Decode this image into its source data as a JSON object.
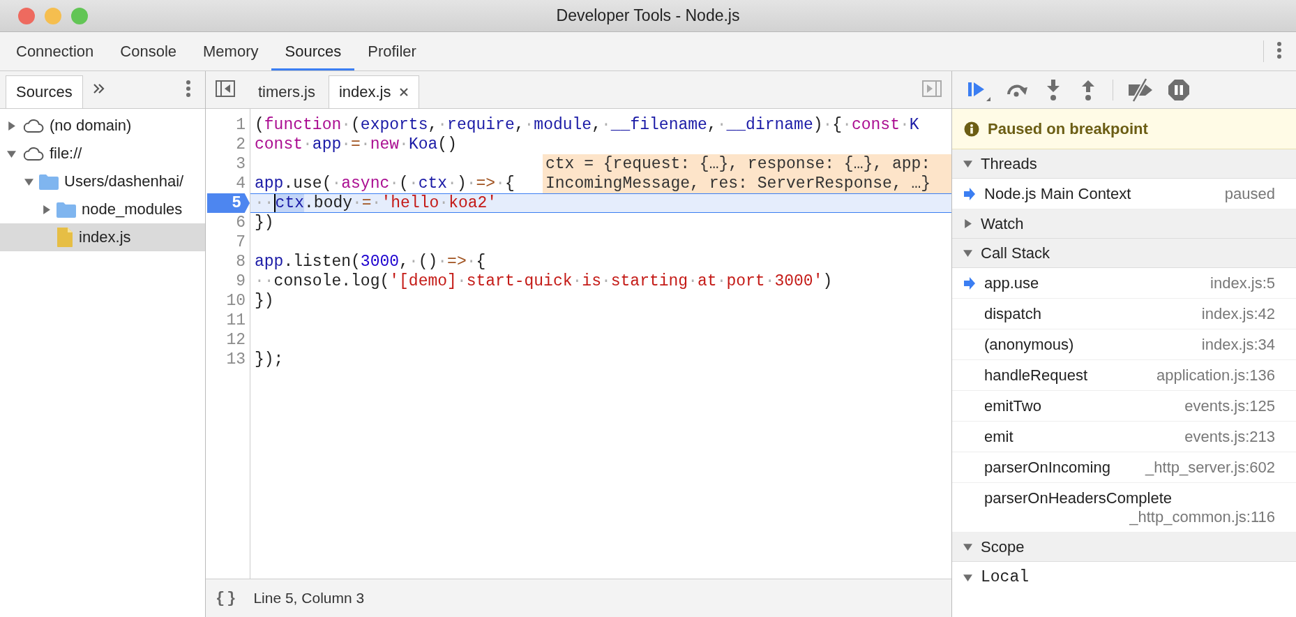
{
  "window": {
    "title": "Developer Tools - Node.js"
  },
  "tabs": [
    {
      "label": "Connection",
      "selected": false
    },
    {
      "label": "Console",
      "selected": false
    },
    {
      "label": "Memory",
      "selected": false
    },
    {
      "label": "Sources",
      "selected": true
    },
    {
      "label": "Profiler",
      "selected": false
    }
  ],
  "sidebar": {
    "tabs": [
      {
        "label": "Sources",
        "selected": true
      }
    ],
    "tree": [
      {
        "label": "(no domain)",
        "kind": "domain",
        "expanded": false,
        "selected": false
      },
      {
        "label": "file://",
        "kind": "domain",
        "expanded": true,
        "selected": false,
        "children": [
          {
            "label": "Users/dashenhai/",
            "kind": "folder",
            "expanded": true,
            "selected": false,
            "children": [
              {
                "label": "node_modules",
                "kind": "folder",
                "expanded": false,
                "selected": false
              },
              {
                "label": "index.js",
                "kind": "file",
                "selected": true
              }
            ]
          }
        ]
      }
    ]
  },
  "editor": {
    "tabs": [
      {
        "label": "timers.js",
        "selected": false,
        "closable": false
      },
      {
        "label": "index.js",
        "selected": true,
        "closable": true
      }
    ],
    "lines": [
      {
        "number": "1",
        "active": false,
        "tokens": [
          {
            "kind": "plain",
            "text": "("
          },
          {
            "kind": "kw",
            "text": "function"
          },
          {
            "kind": "ws",
            "text": "·"
          },
          {
            "kind": "plain",
            "text": "("
          },
          {
            "kind": "var",
            "text": "exports"
          },
          {
            "kind": "plain",
            "text": ","
          },
          {
            "kind": "ws",
            "text": "·"
          },
          {
            "kind": "var",
            "text": "require"
          },
          {
            "kind": "plain",
            "text": ","
          },
          {
            "kind": "ws",
            "text": "·"
          },
          {
            "kind": "var",
            "text": "module"
          },
          {
            "kind": "plain",
            "text": ","
          },
          {
            "kind": "ws",
            "text": "·"
          },
          {
            "kind": "var",
            "text": "__filename"
          },
          {
            "kind": "plain",
            "text": ","
          },
          {
            "kind": "ws",
            "text": "·"
          },
          {
            "kind": "var",
            "text": "__dirname"
          },
          {
            "kind": "plain",
            "text": ")"
          },
          {
            "kind": "ws",
            "text": "·"
          },
          {
            "kind": "plain",
            "text": "{"
          },
          {
            "kind": "ws",
            "text": "·"
          },
          {
            "kind": "kw",
            "text": "const"
          },
          {
            "kind": "ws",
            "text": "·"
          },
          {
            "kind": "var",
            "text": "K"
          }
        ]
      },
      {
        "number": "2",
        "active": false,
        "tokens": [
          {
            "kind": "kw",
            "text": "const"
          },
          {
            "kind": "ws",
            "text": "·"
          },
          {
            "kind": "var",
            "text": "app"
          },
          {
            "kind": "ws",
            "text": "·"
          },
          {
            "kind": "op",
            "text": "="
          },
          {
            "kind": "ws",
            "text": "·"
          },
          {
            "kind": "kw",
            "text": "new"
          },
          {
            "kind": "ws",
            "text": "·"
          },
          {
            "kind": "var",
            "text": "Koa"
          },
          {
            "kind": "plain",
            "text": "()"
          }
        ]
      },
      {
        "number": "3",
        "active": false
      },
      {
        "number": "4",
        "active": false,
        "tokens": [
          {
            "kind": "var",
            "text": "app"
          },
          {
            "kind": "plain",
            "text": ".use("
          },
          {
            "kind": "ws",
            "text": "·"
          },
          {
            "kind": "kw",
            "text": "async"
          },
          {
            "kind": "ws",
            "text": "·"
          },
          {
            "kind": "plain",
            "text": "("
          },
          {
            "kind": "ws",
            "text": "·"
          },
          {
            "kind": "var",
            "text": "ctx"
          },
          {
            "kind": "ws",
            "text": "·"
          },
          {
            "kind": "plain",
            "text": ")"
          },
          {
            "kind": "ws",
            "text": "·"
          },
          {
            "kind": "op",
            "text": "=>"
          },
          {
            "kind": "ws",
            "text": "·"
          },
          {
            "kind": "plain",
            "text": "{"
          }
        ]
      },
      {
        "number": "5",
        "active": true,
        "tokens": [
          {
            "kind": "ws",
            "text": "··"
          },
          {
            "kind": "match",
            "text": "ctx"
          },
          {
            "kind": "plain",
            "text": ".body"
          },
          {
            "kind": "ws",
            "text": "·"
          },
          {
            "kind": "op",
            "text": "="
          },
          {
            "kind": "ws",
            "text": "·"
          },
          {
            "kind": "str",
            "text": "'hello"
          },
          {
            "kind": "ws",
            "text": "·"
          },
          {
            "kind": "str",
            "text": "koa2'"
          }
        ]
      },
      {
        "number": "6",
        "active": false,
        "tokens": [
          {
            "kind": "plain",
            "text": "})"
          }
        ]
      },
      {
        "number": "7",
        "active": false
      },
      {
        "number": "8",
        "active": false,
        "tokens": [
          {
            "kind": "var",
            "text": "app"
          },
          {
            "kind": "plain",
            "text": ".listen("
          },
          {
            "kind": "num",
            "text": "3000"
          },
          {
            "kind": "plain",
            "text": ","
          },
          {
            "kind": "ws",
            "text": "·"
          },
          {
            "kind": "plain",
            "text": "()"
          },
          {
            "kind": "ws",
            "text": "·"
          },
          {
            "kind": "op",
            "text": "=>"
          },
          {
            "kind": "ws",
            "text": "·"
          },
          {
            "kind": "plain",
            "text": "{"
          }
        ]
      },
      {
        "number": "9",
        "active": false,
        "tokens": [
          {
            "kind": "ws",
            "text": "··"
          },
          {
            "kind": "plain",
            "text": "console.log("
          },
          {
            "kind": "str",
            "text": "'[demo]"
          },
          {
            "kind": "ws",
            "text": "·"
          },
          {
            "kind": "str",
            "text": "start-quick"
          },
          {
            "kind": "ws",
            "text": "·"
          },
          {
            "kind": "str",
            "text": "is"
          },
          {
            "kind": "ws",
            "text": "·"
          },
          {
            "kind": "str",
            "text": "starting"
          },
          {
            "kind": "ws",
            "text": "·"
          },
          {
            "kind": "str",
            "text": "at"
          },
          {
            "kind": "ws",
            "text": "·"
          },
          {
            "kind": "str",
            "text": "port"
          },
          {
            "kind": "ws",
            "text": "·"
          },
          {
            "kind": "str",
            "text": "3000'"
          },
          {
            "kind": "plain",
            "text": ")"
          }
        ]
      },
      {
        "number": "10",
        "active": false,
        "tokens": [
          {
            "kind": "plain",
            "text": "})"
          }
        ]
      },
      {
        "number": "11",
        "active": false
      },
      {
        "number": "12",
        "active": false
      },
      {
        "number": "13",
        "active": false,
        "tokens": [
          {
            "kind": "plain",
            "text": "});"
          }
        ]
      }
    ],
    "tooltip": "ctx = {request: {…}, response: {…}, app: IncomingMessage, res: ServerResponse, …}",
    "status": {
      "format_button": "{}",
      "position": "Line 5, Column 3"
    }
  },
  "debugger": {
    "banner": "Paused on breakpoint",
    "sections": [
      {
        "kind": "threads",
        "title": "Threads",
        "expanded": true,
        "items": [
          {
            "name": "Node.js Main Context",
            "status": "paused",
            "selected": true
          }
        ]
      },
      {
        "kind": "watch",
        "title": "Watch",
        "expanded": false
      },
      {
        "kind": "call_stack",
        "title": "Call Stack",
        "expanded": true,
        "frames": [
          {
            "name": "app.use",
            "location": "index.js:5",
            "selected": true
          },
          {
            "name": "dispatch",
            "location": "index.js:42",
            "selected": false
          },
          {
            "name": "(anonymous)",
            "location": "index.js:34",
            "selected": false
          },
          {
            "name": "handleRequest",
            "location": "application.js:136",
            "selected": false
          },
          {
            "name": "emitTwo",
            "location": "events.js:125",
            "selected": false
          },
          {
            "name": "emit",
            "location": "events.js:213",
            "selected": false
          },
          {
            "name": "parserOnIncoming",
            "location": "_http_server.js:602",
            "selected": false
          },
          {
            "name": "parserOnHeadersComplete",
            "location": "_http_common.js:116",
            "selected": false
          }
        ]
      },
      {
        "kind": "scope",
        "title": "Scope",
        "expanded": true,
        "scopes": [
          {
            "name": "Local",
            "expanded": true
          }
        ]
      }
    ]
  }
}
